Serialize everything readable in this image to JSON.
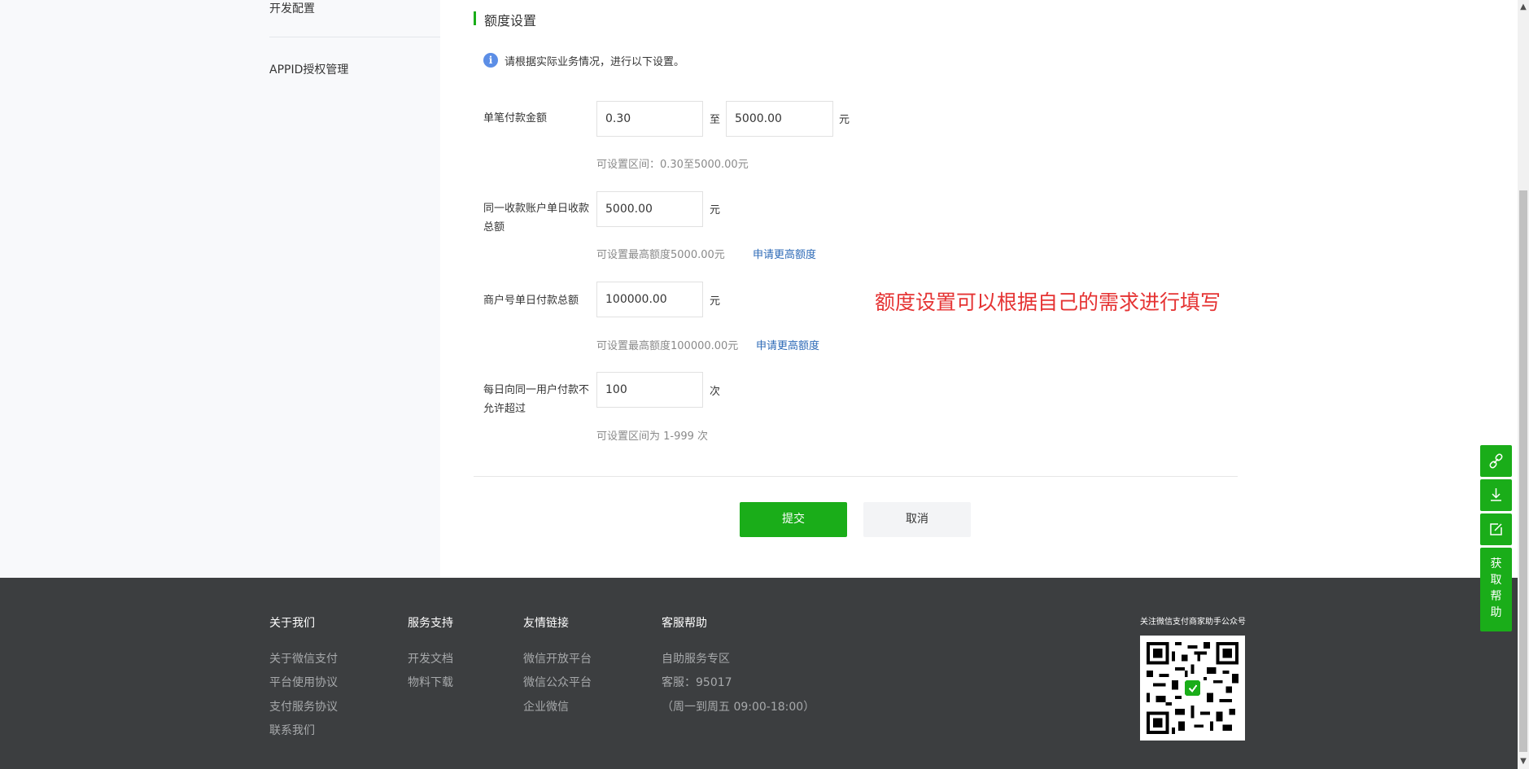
{
  "sidebar": {
    "items": [
      {
        "label": "开发配置"
      },
      {
        "label": "APPID授权管理"
      }
    ]
  },
  "section": {
    "title": "额度设置",
    "info_icon": "info-icon",
    "notice": "请根据实际业务情况，进行以下设置。"
  },
  "form": {
    "single_payment": {
      "label": "单笔付款金额",
      "min_value": "0.30",
      "to_text": "至",
      "max_value": "5000.00",
      "unit": "元",
      "hint": "可设置区间：0.30至5000.00元"
    },
    "daily_same_account": {
      "label": "同一收款账户单日收款总额",
      "value": "5000.00",
      "unit": "元",
      "hint": "可设置最高额度5000.00元",
      "link": "申请更高额度"
    },
    "merchant_daily": {
      "label": "商户号单日付款总额",
      "value": "100000.00",
      "unit": "元",
      "hint": "可设置最高额度100000.00元",
      "link": "申请更高额度"
    },
    "daily_user_count": {
      "label": "每日向同一用户付款不允许超过",
      "value": "100",
      "unit": "次",
      "hint": "可设置区间为 1-999 次"
    }
  },
  "annotation": "额度设置可以根据自己的需求进行填写",
  "actions": {
    "submit": "提交",
    "cancel": "取消"
  },
  "footer": {
    "columns": [
      {
        "title": "关于我们",
        "links": [
          "关于微信支付",
          "平台使用协议",
          "支付服务协议",
          "联系我们"
        ]
      },
      {
        "title": "服务支持",
        "links": [
          "开发文档",
          "物料下载"
        ]
      },
      {
        "title": "友情链接",
        "links": [
          "微信开放平台",
          "微信公众平台",
          "企业微信"
        ]
      },
      {
        "title": "客服帮助",
        "links": [
          "自助服务专区",
          "客服：95017",
          "（周一到周五 09:00-18:00）"
        ]
      }
    ],
    "qr_caption": "关注微信支付商家助手公众号"
  },
  "tools": {
    "icons": [
      "link-icon",
      "download-icon",
      "edit-icon"
    ],
    "help_label": "获取帮助"
  },
  "colors": {
    "accent": "#1aad19",
    "link": "#2d6ab7",
    "annotation": "#e53333",
    "footer_bg": "#3c3e40"
  }
}
